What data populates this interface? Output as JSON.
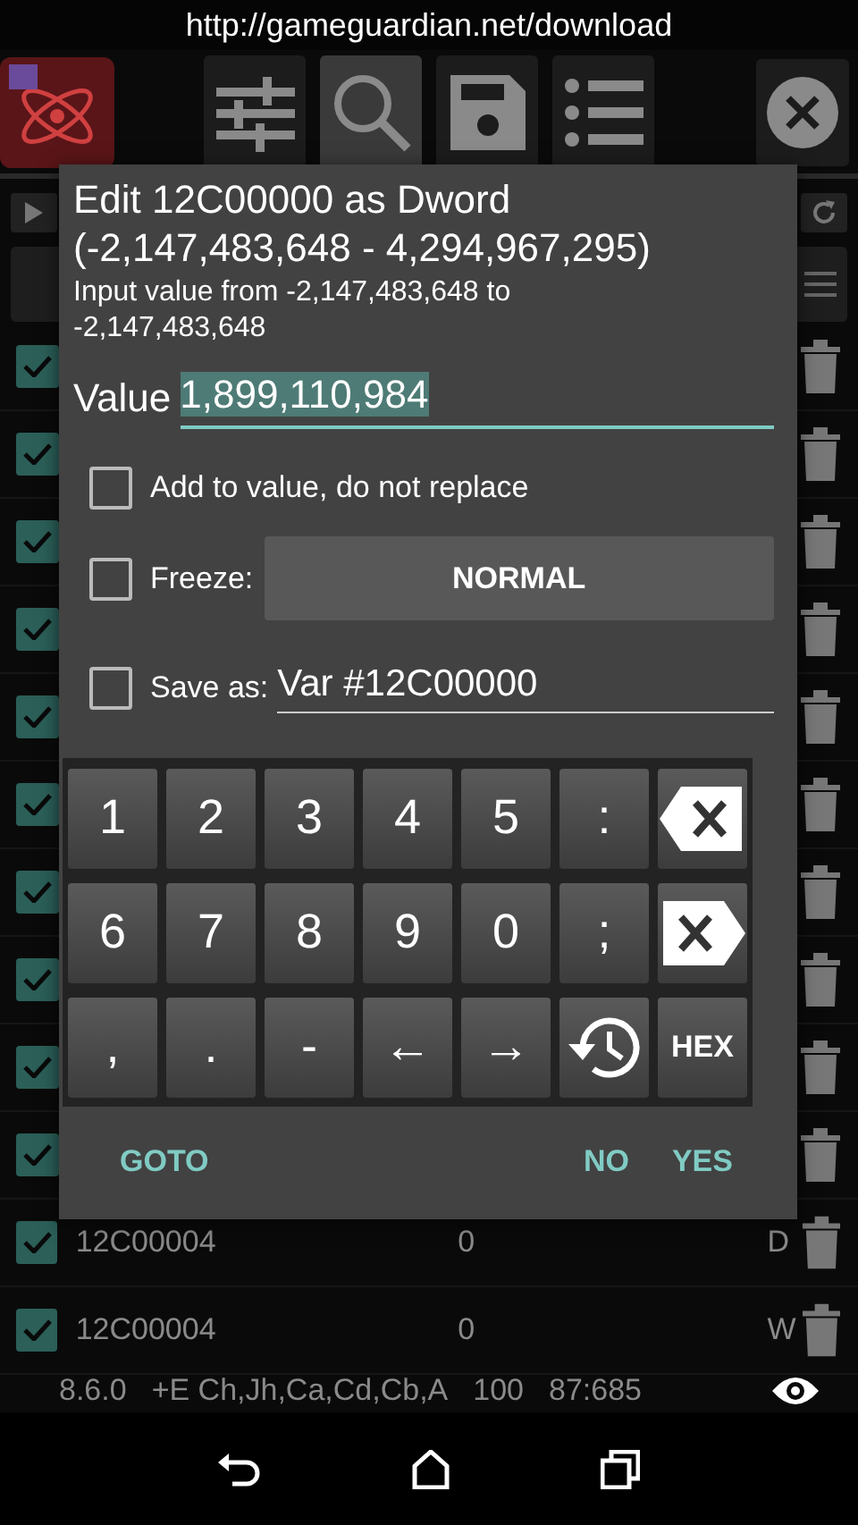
{
  "url_banner": "http://gameguardian.net/download",
  "toolbar": {
    "buttons": [
      {
        "kind": "sliders",
        "selected": false
      },
      {
        "kind": "search",
        "selected": true
      },
      {
        "kind": "save",
        "selected": false
      },
      {
        "kind": "list",
        "selected": false
      }
    ]
  },
  "saved_list": {
    "rows": [
      {
        "checked": true
      },
      {
        "checked": true
      },
      {
        "checked": true
      },
      {
        "checked": true
      },
      {
        "checked": true
      },
      {
        "checked": true
      },
      {
        "checked": true
      },
      {
        "checked": true
      },
      {
        "checked": true
      },
      {
        "checked": true
      },
      {
        "checked": true,
        "address": "12C00004",
        "value": "0",
        "type": "D"
      },
      {
        "checked": true,
        "address": "12C00004",
        "value": "0",
        "type": "W"
      }
    ]
  },
  "status_line": {
    "version": "8.6.0",
    "flags": "+E Ch,Jh,Ca,Cd,Cb,A",
    "count": "100",
    "ratio": "87:685"
  },
  "dialog": {
    "title": "Edit 12C00000 as Dword (-2,147,483,648 - 4,294,967,295)",
    "hint": "Input value from -2,147,483,648 to -2,147,483,648",
    "value_label": "Value",
    "value": "1,899,110,984",
    "options": [
      {
        "kind": "checkbox",
        "label": "Add to value, do not replace",
        "checked": false
      },
      {
        "kind": "freeze",
        "label": "Freeze:",
        "checked": false,
        "mode": "NORMAL"
      },
      {
        "kind": "save_as",
        "label": "Save as:",
        "checked": false,
        "value": "Var #12C00000"
      }
    ],
    "keypad": [
      [
        {
          "kind": "char",
          "label": "1"
        },
        {
          "kind": "char",
          "label": "2"
        },
        {
          "kind": "char",
          "label": "3"
        },
        {
          "kind": "char",
          "label": "4"
        },
        {
          "kind": "char",
          "label": "5"
        },
        {
          "kind": "char",
          "label": ":"
        },
        {
          "kind": "backspace"
        }
      ],
      [
        {
          "kind": "char",
          "label": "6"
        },
        {
          "kind": "char",
          "label": "7"
        },
        {
          "kind": "char",
          "label": "8"
        },
        {
          "kind": "char",
          "label": "9"
        },
        {
          "kind": "char",
          "label": "0"
        },
        {
          "kind": "char",
          "label": ";"
        },
        {
          "kind": "delete"
        }
      ],
      [
        {
          "kind": "char",
          "label": ","
        },
        {
          "kind": "char",
          "label": "."
        },
        {
          "kind": "char",
          "label": "-"
        },
        {
          "kind": "char",
          "label": "←"
        },
        {
          "kind": "char",
          "label": "→"
        },
        {
          "kind": "history"
        },
        {
          "kind": "small",
          "label": "HEX"
        }
      ]
    ],
    "buttons": [
      {
        "label": "GOTO"
      },
      {
        "label": "NO"
      },
      {
        "label": "YES"
      }
    ]
  }
}
